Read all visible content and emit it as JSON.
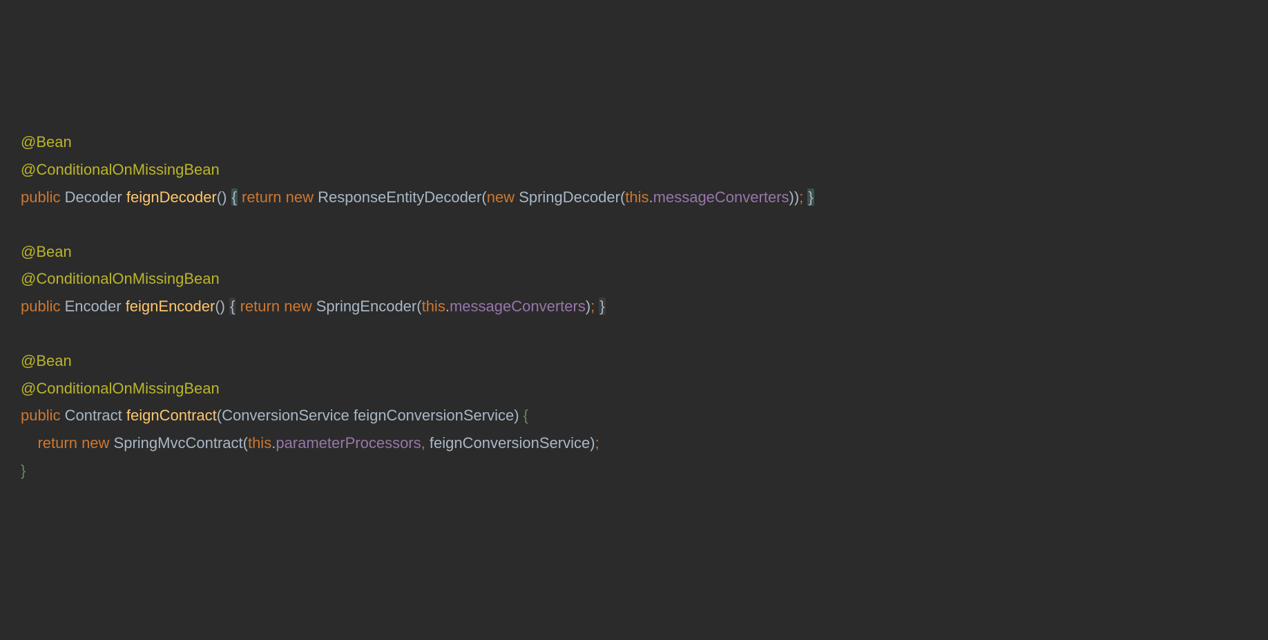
{
  "code": {
    "methods": [
      {
        "annotation1": "@Bean",
        "annotation2": "@ConditionalOnMissingBean",
        "modifier": "public",
        "returnType": "Decoder",
        "name": "feignDecoder",
        "params": "",
        "returnKw": "return",
        "newKw": "new",
        "class1": "ResponseEntityDecoder",
        "newKw2": "new",
        "class2": "SpringDecoder",
        "thisKw": "this",
        "field": "messageConverters"
      },
      {
        "annotation1": "@Bean",
        "annotation2": "@ConditionalOnMissingBean",
        "modifier": "public",
        "returnType": "Encoder",
        "name": "feignEncoder",
        "params": "",
        "returnKw": "return",
        "newKw": "new",
        "class1": "SpringEncoder",
        "thisKw": "this",
        "field": "messageConverters"
      },
      {
        "annotation1": "@Bean",
        "annotation2": "@ConditionalOnMissingBean",
        "modifier": "public",
        "returnType": "Contract",
        "name": "feignContract",
        "paramType": "ConversionService",
        "paramName": "feignConversionService",
        "returnKw": "return",
        "newKw": "new",
        "class1": "SpringMvcContract",
        "thisKw": "this",
        "field": "parameterProcessors",
        "arg2": "feignConversionService"
      }
    ]
  }
}
